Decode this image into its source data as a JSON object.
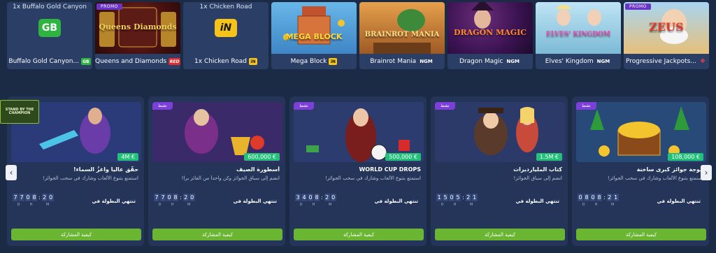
{
  "games": [
    {
      "top_label": "1x Buffalo Gold Canyon",
      "caption": "Buffalo Gold Canyon...",
      "provider": "GB",
      "provider_style": "gb",
      "logo": "GB",
      "art": "logo-gb"
    },
    {
      "promo": "PROMO",
      "art_title": "Queens Diamonds",
      "caption": "Queens and Diamonds",
      "provider": "RED",
      "provider_style": "red",
      "art": "queens"
    },
    {
      "top_label": "1x Chicken Road",
      "caption": "1x Chicken Road",
      "provider": "iN",
      "provider_style": "in",
      "logo": "iN",
      "art": "logo-in"
    },
    {
      "art_title": "MEGA BLOCK",
      "caption": "Mega Block",
      "provider": "iN",
      "provider_style": "in",
      "art": "mega"
    },
    {
      "art_title": "BRAINROT MANIA",
      "caption": "Brainrot Mania",
      "provider": "NGM",
      "provider_style": "ngm",
      "art": "brainrot"
    },
    {
      "art_title": "DRAGON MAGIC",
      "caption": "Dragon Magic",
      "provider": "NGM",
      "provider_style": "ngm",
      "art": "dragon"
    },
    {
      "art_title": "ELVES' KINGDOM",
      "caption": "Elves' Kingdom",
      "provider": "NGM",
      "provider_style": "ngm",
      "art": "elves"
    },
    {
      "promo": "PROMO",
      "art_title": "ZEUS",
      "caption": "Progressive Jackpots...",
      "provider": "❖",
      "provider_style": "jp",
      "art": "zeus"
    }
  ],
  "stand_badge": "STAND BY THE CHAMPION",
  "tournaments": [
    {
      "badge": "",
      "prize": "4M €",
      "title": "حقّق عالياً واغزُ السماء!",
      "desc": "استمتع بتنوع الألعاب وشارك في سحب الجوائز!",
      "ends_label": "تنتهي البطولة في",
      "timer": {
        "d": "77",
        "h": "08",
        "m": "20"
      },
      "cta": "كيفية المشاركة",
      "art": "hero"
    },
    {
      "badge": "نشط",
      "prize": "600,000 €",
      "title": "أسطورة الصيف",
      "desc": "انضم إلى سباق الجوائز وكن واحداً من الفائز برا!",
      "ends_label": "تنتهي البطولة في",
      "timer": {
        "d": "77",
        "h": "08",
        "m": "20"
      },
      "cta": "كيفية المشاركة",
      "art": "jester"
    },
    {
      "badge": "نشط",
      "prize": "500,000 €",
      "title": "WORLD CUP DROPS",
      "desc": "استمتع بتنوع الألعاب وشارك في سحب الجوائز!",
      "ends_label": "تنتهي البطولة في",
      "timer": {
        "d": "34",
        "h": "08",
        "m": "20"
      },
      "cta": "كيفية المشاركة",
      "art": "worldcup"
    },
    {
      "badge": "نشط",
      "prize": "1.5M €",
      "title": "كتاب المليارديرات",
      "desc": "انضم إلى سباق الجوائز!",
      "ends_label": "تنتهي البطولة في",
      "timer": {
        "d": "15",
        "h": "05",
        "m": "21"
      },
      "cta": "كيفية المشاركة",
      "art": "billionaire"
    },
    {
      "badge": "نشط",
      "prize": "108,000 €",
      "title": "موجة جوائز كبرى ساخنة",
      "desc": "استمتع بتنوع الألعاب وشارك في سحب الجوائز!",
      "ends_label": "تنتهي البطولة في",
      "timer": {
        "d": "08",
        "h": "08",
        "m": "21"
      },
      "cta": "كيفية المشاركة",
      "art": "treasure"
    }
  ],
  "timer_labels": {
    "d": "D",
    "h": "H",
    "m": "M"
  },
  "nav": {
    "prev": "‹",
    "next": "›"
  }
}
